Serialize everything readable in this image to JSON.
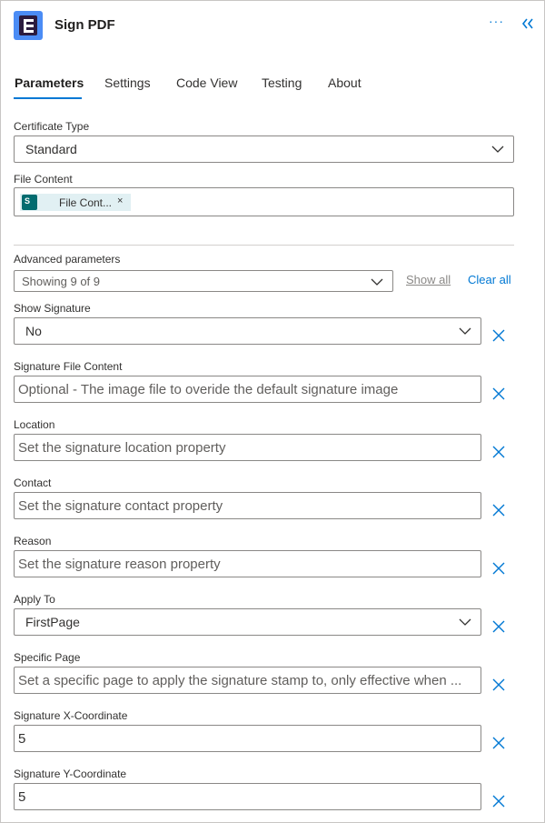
{
  "header": {
    "title": "Sign PDF",
    "more_label": "···",
    "collapse_icon": "double-chevron-left-icon",
    "accent": "#0078d4"
  },
  "tabs": [
    {
      "label": "Parameters",
      "active": true
    },
    {
      "label": "Settings",
      "active": false
    },
    {
      "label": "Code View",
      "active": false
    },
    {
      "label": "Testing",
      "active": false
    },
    {
      "label": "About",
      "active": false
    }
  ],
  "certificate_type": {
    "label": "Certificate Type",
    "value": "Standard"
  },
  "file_content": {
    "label": "File Content",
    "chip_text": "File Cont...",
    "chip_icon": "sharepoint-icon",
    "chip_icon_glyph": "S"
  },
  "advanced": {
    "label": "Advanced parameters",
    "value": "Showing 9 of 9",
    "show_all": "Show all",
    "clear_all": "Clear all"
  },
  "show_signature": {
    "label": "Show Signature",
    "value": "No"
  },
  "signature_file_content": {
    "label": "Signature File Content",
    "placeholder": "Optional - The image file to overide the default signature image"
  },
  "location": {
    "label": "Location",
    "placeholder": "Set the signature location property"
  },
  "contact": {
    "label": "Contact",
    "placeholder": "Set the signature contact property"
  },
  "reason": {
    "label": "Reason",
    "placeholder": "Set the signature reason property"
  },
  "apply_to": {
    "label": "Apply To",
    "value": "FirstPage"
  },
  "specific_page": {
    "label": "Specific Page",
    "placeholder": "Set a specific page to apply the signature stamp to, only effective when ..."
  },
  "x_coordinate": {
    "label": "Signature X-Coordinate",
    "value": "5"
  },
  "y_coordinate": {
    "label": "Signature Y-Coordinate",
    "value": "5"
  }
}
